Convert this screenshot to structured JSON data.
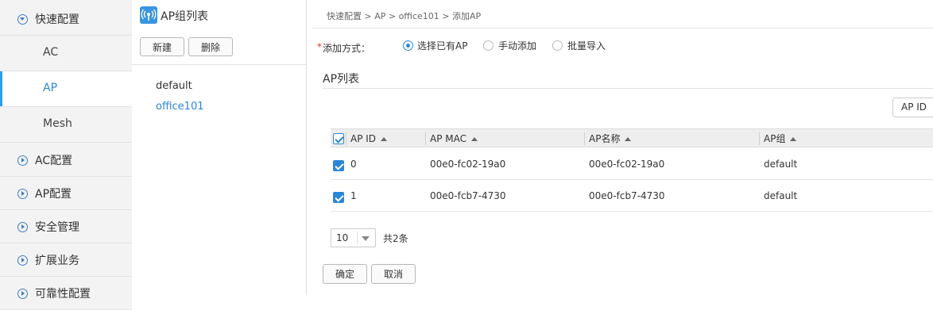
{
  "nav": {
    "quick_config": "快速配置",
    "sub_items": [
      "AC",
      "AP",
      "Mesh"
    ],
    "ac_config": "AC配置",
    "ap_config": "AP配置",
    "security": "安全管理",
    "extension": "扩展业务",
    "reliability": "可靠性配置"
  },
  "group_panel": {
    "title": "AP组列表",
    "new_label": "新建",
    "delete_label": "删除",
    "groups": [
      "default",
      "office101"
    ]
  },
  "breadcrumb": "快速配置 > AP > office101 > 添加AP",
  "add_mode": {
    "required_mark": "*",
    "label": "添加方式：",
    "options": [
      "选择已有AP",
      "手动添加",
      "批量导入"
    ],
    "selected": "选择已有AP"
  },
  "ap_list": {
    "title": "AP列表",
    "search_button": "AP ID",
    "columns": [
      "AP ID",
      "AP MAC",
      "AP名称",
      "AP组"
    ],
    "rows": [
      {
        "id": "0",
        "mac": "00e0-fc02-19a0",
        "name": "00e0-fc02-19a0",
        "group": "default"
      },
      {
        "id": "1",
        "mac": "00e0-fcb7-4730",
        "name": "00e0-fcb7-4730",
        "group": "default"
      }
    ],
    "page_size": "10",
    "total": "共2条"
  },
  "actions": {
    "confirm": "确定",
    "cancel": "取消"
  },
  "colors": {
    "accent": "#2a86d9",
    "nav_bg": "#f3f3f3",
    "icon_bg": "#3a95e0"
  }
}
